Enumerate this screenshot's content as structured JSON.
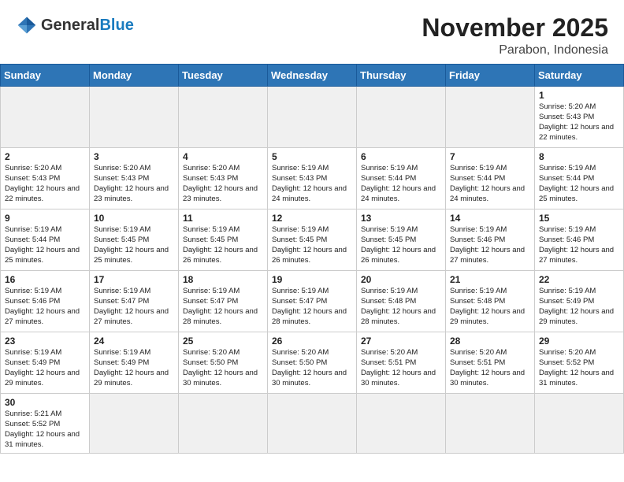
{
  "header": {
    "logo_general": "General",
    "logo_blue": "Blue",
    "month_title": "November 2025",
    "location": "Parabon, Indonesia"
  },
  "days_of_week": [
    "Sunday",
    "Monday",
    "Tuesday",
    "Wednesday",
    "Thursday",
    "Friday",
    "Saturday"
  ],
  "weeks": [
    [
      {
        "day": "",
        "info": "",
        "empty": true
      },
      {
        "day": "",
        "info": "",
        "empty": true
      },
      {
        "day": "",
        "info": "",
        "empty": true
      },
      {
        "day": "",
        "info": "",
        "empty": true
      },
      {
        "day": "",
        "info": "",
        "empty": true
      },
      {
        "day": "",
        "info": "",
        "empty": true
      },
      {
        "day": "1",
        "info": "Sunrise: 5:20 AM\nSunset: 5:43 PM\nDaylight: 12 hours\nand 22 minutes."
      }
    ],
    [
      {
        "day": "2",
        "info": "Sunrise: 5:20 AM\nSunset: 5:43 PM\nDaylight: 12 hours\nand 22 minutes."
      },
      {
        "day": "3",
        "info": "Sunrise: 5:20 AM\nSunset: 5:43 PM\nDaylight: 12 hours\nand 23 minutes."
      },
      {
        "day": "4",
        "info": "Sunrise: 5:20 AM\nSunset: 5:43 PM\nDaylight: 12 hours\nand 23 minutes."
      },
      {
        "day": "5",
        "info": "Sunrise: 5:19 AM\nSunset: 5:43 PM\nDaylight: 12 hours\nand 24 minutes."
      },
      {
        "day": "6",
        "info": "Sunrise: 5:19 AM\nSunset: 5:44 PM\nDaylight: 12 hours\nand 24 minutes."
      },
      {
        "day": "7",
        "info": "Sunrise: 5:19 AM\nSunset: 5:44 PM\nDaylight: 12 hours\nand 24 minutes."
      },
      {
        "day": "8",
        "info": "Sunrise: 5:19 AM\nSunset: 5:44 PM\nDaylight: 12 hours\nand 25 minutes."
      }
    ],
    [
      {
        "day": "9",
        "info": "Sunrise: 5:19 AM\nSunset: 5:44 PM\nDaylight: 12 hours\nand 25 minutes."
      },
      {
        "day": "10",
        "info": "Sunrise: 5:19 AM\nSunset: 5:45 PM\nDaylight: 12 hours\nand 25 minutes."
      },
      {
        "day": "11",
        "info": "Sunrise: 5:19 AM\nSunset: 5:45 PM\nDaylight: 12 hours\nand 26 minutes."
      },
      {
        "day": "12",
        "info": "Sunrise: 5:19 AM\nSunset: 5:45 PM\nDaylight: 12 hours\nand 26 minutes."
      },
      {
        "day": "13",
        "info": "Sunrise: 5:19 AM\nSunset: 5:45 PM\nDaylight: 12 hours\nand 26 minutes."
      },
      {
        "day": "14",
        "info": "Sunrise: 5:19 AM\nSunset: 5:46 PM\nDaylight: 12 hours\nand 27 minutes."
      },
      {
        "day": "15",
        "info": "Sunrise: 5:19 AM\nSunset: 5:46 PM\nDaylight: 12 hours\nand 27 minutes."
      }
    ],
    [
      {
        "day": "16",
        "info": "Sunrise: 5:19 AM\nSunset: 5:46 PM\nDaylight: 12 hours\nand 27 minutes."
      },
      {
        "day": "17",
        "info": "Sunrise: 5:19 AM\nSunset: 5:47 PM\nDaylight: 12 hours\nand 27 minutes."
      },
      {
        "day": "18",
        "info": "Sunrise: 5:19 AM\nSunset: 5:47 PM\nDaylight: 12 hours\nand 28 minutes."
      },
      {
        "day": "19",
        "info": "Sunrise: 5:19 AM\nSunset: 5:47 PM\nDaylight: 12 hours\nand 28 minutes."
      },
      {
        "day": "20",
        "info": "Sunrise: 5:19 AM\nSunset: 5:48 PM\nDaylight: 12 hours\nand 28 minutes."
      },
      {
        "day": "21",
        "info": "Sunrise: 5:19 AM\nSunset: 5:48 PM\nDaylight: 12 hours\nand 29 minutes."
      },
      {
        "day": "22",
        "info": "Sunrise: 5:19 AM\nSunset: 5:49 PM\nDaylight: 12 hours\nand 29 minutes."
      }
    ],
    [
      {
        "day": "23",
        "info": "Sunrise: 5:19 AM\nSunset: 5:49 PM\nDaylight: 12 hours\nand 29 minutes."
      },
      {
        "day": "24",
        "info": "Sunrise: 5:19 AM\nSunset: 5:49 PM\nDaylight: 12 hours\nand 29 minutes."
      },
      {
        "day": "25",
        "info": "Sunrise: 5:20 AM\nSunset: 5:50 PM\nDaylight: 12 hours\nand 30 minutes."
      },
      {
        "day": "26",
        "info": "Sunrise: 5:20 AM\nSunset: 5:50 PM\nDaylight: 12 hours\nand 30 minutes."
      },
      {
        "day": "27",
        "info": "Sunrise: 5:20 AM\nSunset: 5:51 PM\nDaylight: 12 hours\nand 30 minutes."
      },
      {
        "day": "28",
        "info": "Sunrise: 5:20 AM\nSunset: 5:51 PM\nDaylight: 12 hours\nand 30 minutes."
      },
      {
        "day": "29",
        "info": "Sunrise: 5:20 AM\nSunset: 5:52 PM\nDaylight: 12 hours\nand 31 minutes."
      }
    ],
    [
      {
        "day": "30",
        "info": "Sunrise: 5:21 AM\nSunset: 5:52 PM\nDaylight: 12 hours\nand 31 minutes.",
        "last": true
      },
      {
        "day": "",
        "info": "",
        "empty": true,
        "last": true
      },
      {
        "day": "",
        "info": "",
        "empty": true,
        "last": true
      },
      {
        "day": "",
        "info": "",
        "empty": true,
        "last": true
      },
      {
        "day": "",
        "info": "",
        "empty": true,
        "last": true
      },
      {
        "day": "",
        "info": "",
        "empty": true,
        "last": true
      },
      {
        "day": "",
        "info": "",
        "empty": true,
        "last": true
      }
    ]
  ]
}
